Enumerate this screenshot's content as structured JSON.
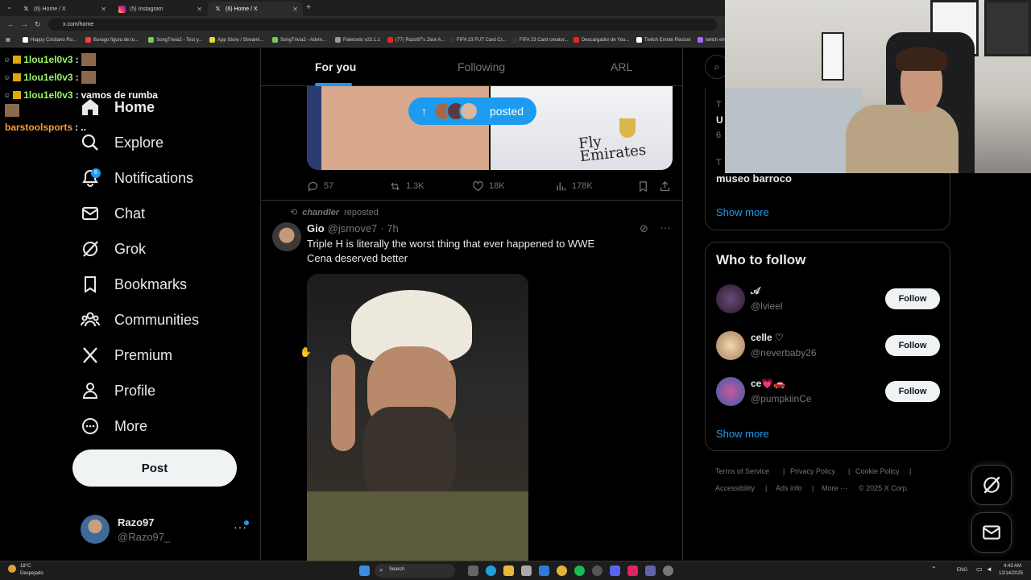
{
  "browser": {
    "tabs": [
      {
        "title": "(6) Home / X",
        "icon": "x-logo"
      },
      {
        "title": "(5) Instagram",
        "icon": "instagram-logo"
      },
      {
        "title": "(6) Home / X",
        "icon": "x-logo"
      }
    ],
    "new_tab": "+",
    "url": "x.com/home",
    "bookmarks": [
      "Happy Cristiano Ro...",
      "Burago figura de to...",
      "SongTrivia2 - Test y...",
      "App Store / Streami...",
      "SongTrivia2 - Advin...",
      "Paletools v23.1.1",
      "(77) Razo97's Zest-A...",
      "FIFA 23 FUT Card Cr...",
      "FIFA 23 Card creator...",
      "Descargador de You...",
      "Twitch Emote Resizer",
      "twitch em"
    ]
  },
  "chat_overlay": [
    {
      "user": "1lou1el0v3",
      "sep": ":",
      "msg": "",
      "color": "#9cf56b"
    },
    {
      "user": "1lou1el0v3",
      "sep": ":",
      "msg": "",
      "color": "#9cf56b"
    },
    {
      "user": "1lou1el0v3",
      "sep": ":",
      "msg": "vamos de rumba",
      "color": "#9cf56b"
    },
    {
      "user": "barstoolsports",
      "sep": ": ..",
      "msg": "",
      "color": "#ff9c33"
    }
  ],
  "sidebar": {
    "items": [
      {
        "label": "Home",
        "icon": "home-icon"
      },
      {
        "label": "Explore",
        "icon": "search-icon"
      },
      {
        "label": "Notifications",
        "icon": "bell-icon",
        "badge": "6"
      },
      {
        "label": "Chat",
        "icon": "mail-icon"
      },
      {
        "label": "Grok",
        "icon": "grok-icon"
      },
      {
        "label": "Bookmarks",
        "icon": "bookmark-icon"
      },
      {
        "label": "Communities",
        "icon": "communities-icon"
      },
      {
        "label": "Premium",
        "icon": "x-logo-icon"
      },
      {
        "label": "Profile",
        "icon": "profile-icon"
      },
      {
        "label": "More",
        "icon": "more-circle-icon"
      }
    ],
    "post_label": "Post",
    "account": {
      "name": "Razo97",
      "handle": "@Razo97_"
    }
  },
  "main": {
    "tabs": [
      {
        "label": "For you",
        "active": true
      },
      {
        "label": "Following",
        "active": false
      },
      {
        "label": "ARL",
        "active": false
      }
    ],
    "posted_pill": "posted",
    "prev_tweet": {
      "replies": "57",
      "reposts": "1.3K",
      "likes": "18K",
      "views": "178K",
      "jersey_text": "Fly\nEmirates"
    },
    "tweet": {
      "repost_by": "chandler",
      "repost_label": "reposted",
      "author": "Gio",
      "handle": "@jsmove7",
      "time": "· 7h",
      "text_line1": "Triple H is literally the worst thing that ever happened to WWE",
      "text_line2": "Cena deserved better",
      "more": "···"
    }
  },
  "right": {
    "trend_partial_1": "T",
    "trend_partial_2": "U",
    "trend_partial_3": "6",
    "trend_partial_4": "T",
    "trend_title": "museo barroco",
    "show_more": "Show more",
    "who_to_follow_title": "Who to follow",
    "who_to_follow": [
      {
        "name": "𝒜",
        "handle": "@lvieel"
      },
      {
        "name": "celle ♡",
        "handle": "@neverbaby26"
      },
      {
        "name": "ce💗🚗",
        "handle": "@pumpkiinCe"
      }
    ],
    "follow_label": "Follow",
    "show_more_2": "Show more",
    "footer": {
      "terms": "Terms of Service",
      "privacy": "Privacy Policy",
      "cookie": "Cookie Policy",
      "accessibility": "Accessibility",
      "ads": "Ads info",
      "more": "More ···",
      "copyright": "© 2025 X Corp."
    }
  },
  "taskbar": {
    "weather_temp": "18°C",
    "weather_desc": "Despejado",
    "search": "Search",
    "lang": "ENG",
    "time": "4:43 AM",
    "date": "12/14/2025"
  }
}
